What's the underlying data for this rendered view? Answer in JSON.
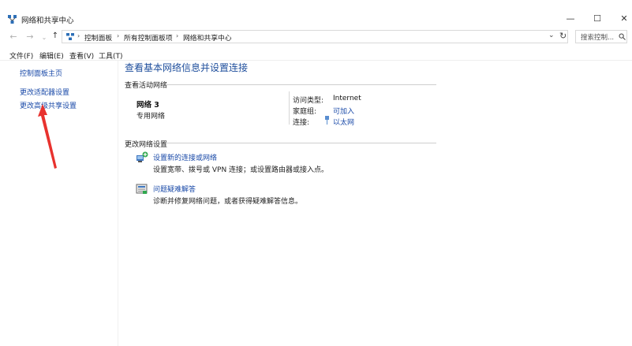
{
  "window": {
    "title": "网络和共享中心",
    "controls": {
      "minimize": "—",
      "maximize": "☐",
      "close": "✕"
    }
  },
  "address_bar": {
    "nav": {
      "back": "←",
      "forward": "→",
      "recent": "⌄",
      "up": "↑"
    },
    "breadcrumbs": [
      "控制面板",
      "所有控制面板项",
      "网络和共享中心"
    ],
    "separator": "›",
    "dropdown": "⌄",
    "refresh": "↻",
    "search_text": "搜索控制..."
  },
  "menu": {
    "items": [
      "文件(F)",
      "编辑(E)",
      "查看(V)",
      "工具(T)"
    ]
  },
  "left_pane": {
    "links": [
      "控制面板主页",
      "更改适配器设置",
      "更改高级共享设置"
    ]
  },
  "main": {
    "title": "查看基本网络信息并设置连接",
    "active_section_label": "查看活动网络",
    "network": {
      "name": "网络  3",
      "type": "专用网络",
      "access_type_label": "访问类型:",
      "access_type_value": "Internet",
      "homegroup_label": "家庭组:",
      "homegroup_value": "可加入",
      "connection_label": "连接:",
      "connection_value": "以太网"
    },
    "change_section_label": "更改网络设置",
    "tasks": [
      {
        "link": "设置新的连接或网络",
        "desc": "设置宽带、拨号或 VPN 连接；或设置路由器或接入点。"
      },
      {
        "link": "问题疑难解答",
        "desc": "诊断并修复网络问题，或者获得疑难解答信息。"
      }
    ]
  },
  "colors": {
    "link": "#1a4aa8",
    "title": "#1e4e9c",
    "annotation_arrow": "#e8322e"
  }
}
